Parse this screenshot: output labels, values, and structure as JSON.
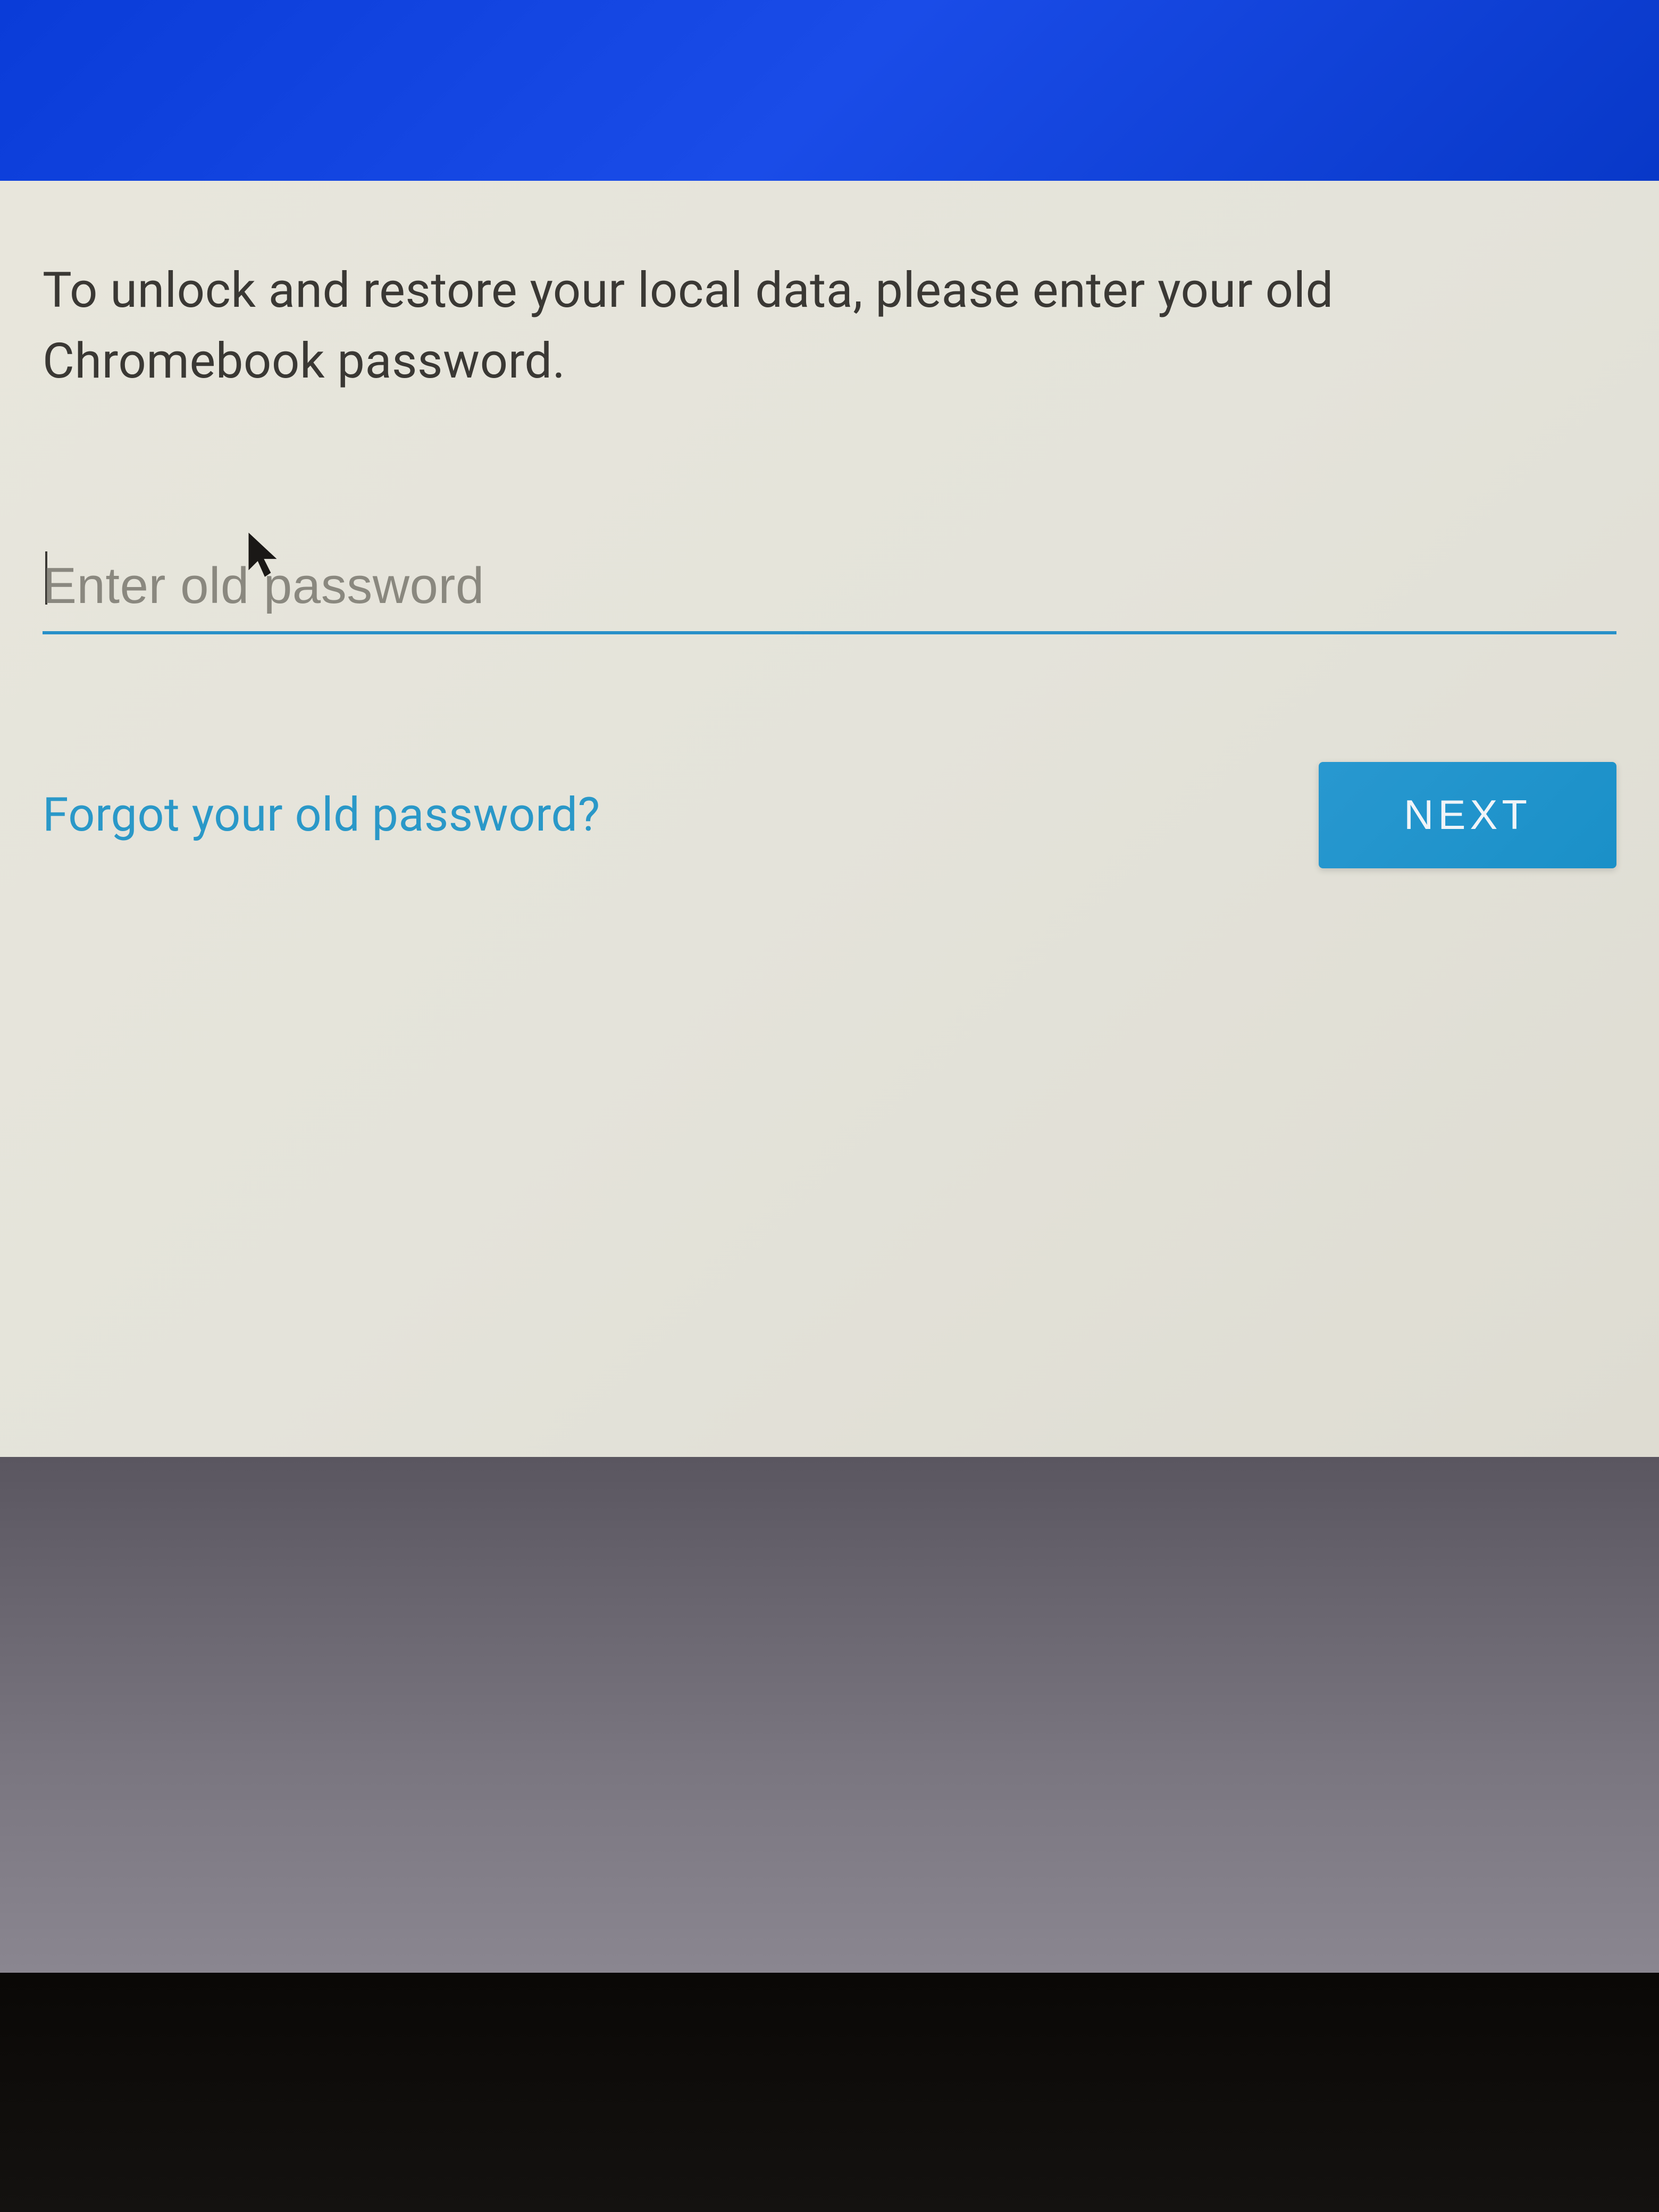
{
  "dialog": {
    "instruction": "To unlock and restore your local data, please enter your old Chromebook password.",
    "password_placeholder": "Enter old password",
    "password_value": "",
    "forgot_link": "Forgot your old password?",
    "next_button": "NEXT"
  },
  "colors": {
    "header_blue": "#1a4ce8",
    "accent_blue": "#2898d0",
    "link_blue": "#2a98c8",
    "panel_bg": "#e4e3da",
    "text_dark": "#3a3834"
  }
}
